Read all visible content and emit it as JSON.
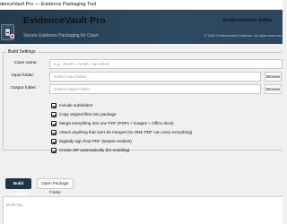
{
  "window": {
    "title": "denceVault Pro — Evidence Packaging Tool"
  },
  "header": {
    "app_title": "EvidenceVault Pro",
    "tagline": "Secure Evidence Packaging for Court",
    "brand": "EvidenceVault Softw",
    "copyright": "© 2025 EvidenceVault Software. All rights reserved."
  },
  "settings": {
    "legend": "Build Settings",
    "case_name": {
      "label": "Case name:",
      "value": "",
      "placeholder": "e.g., Smith v Smith / Jan 2026"
    },
    "input_folder": {
      "label": "Input folder:",
      "value": "",
      "placeholder": "Select input folder...",
      "browse": "Browse"
    },
    "output_folder": {
      "label": "Output folder:",
      "value": "",
      "placeholder": "Select output folder...",
      "browse": "Browse"
    },
    "options": [
      {
        "label": "Include subfolders",
        "checked": true
      },
      {
        "label": "Copy original files into package",
        "checked": true
      },
      {
        "label": "Merge everything into one PDF (PDFs + images + Office docs)",
        "checked": true
      },
      {
        "label": "Attach anything that can't be merged (so ONE PDF can carry everything)",
        "checked": true
      },
      {
        "label": "Digitally sign final PDF (tamper-evident)",
        "checked": true
      },
      {
        "label": "Create ZIP automatically (for emailing)",
        "checked": true
      }
    ]
  },
  "actions": {
    "build": "Build Package",
    "open": "Open Package Folder"
  },
  "log": {
    "placeholder": "Build log..."
  },
  "colors": {
    "header_bg": "#2b4459",
    "primary_button": "#1f3447"
  }
}
